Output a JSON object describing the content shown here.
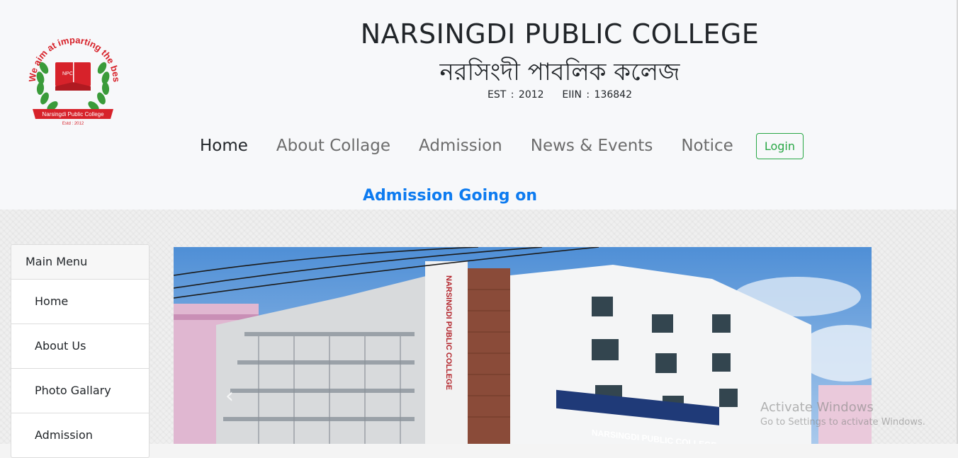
{
  "header": {
    "college_name_en": "NARSINGDI PUBLIC COLLEGE",
    "college_name_bn": "নরসিংদী পাবলিক কলেজ",
    "est_line": "EST : 2012    EIIN : 136842"
  },
  "logo": {
    "motto": "We aim at imparting the best education",
    "banner": "Narsingdi Public College",
    "estd": "Estd : 2012",
    "badge": "NPC"
  },
  "nav": {
    "items": [
      {
        "label": "Home",
        "active": true
      },
      {
        "label": "About Collage"
      },
      {
        "label": "Admission"
      },
      {
        "label": "News & Events"
      },
      {
        "label": "Notice"
      }
    ],
    "login_label": "Login"
  },
  "marquee": {
    "text": "Admission Going on"
  },
  "sidebar": {
    "header": "Main Menu",
    "items": [
      {
        "label": "Home"
      },
      {
        "label": "About Us"
      },
      {
        "label": "Photo Gallary"
      },
      {
        "label": "Admission"
      }
    ]
  },
  "slider": {
    "sign_text": "NARSINGDI PUBLIC COLLEGE",
    "vertical_sign": "NARSINGDI PUBLIC COLLEGE",
    "prev_icon": "chevron-left-icon",
    "next_icon": "chevron-right-icon"
  },
  "watermark": {
    "title": "Activate Windows",
    "subtitle": "Go to Settings to activate Windows."
  },
  "colors": {
    "accent_blue": "#0d7bf0",
    "login_green": "#28a745",
    "logo_red": "#d7222a",
    "logo_green": "#3a9b3a"
  }
}
